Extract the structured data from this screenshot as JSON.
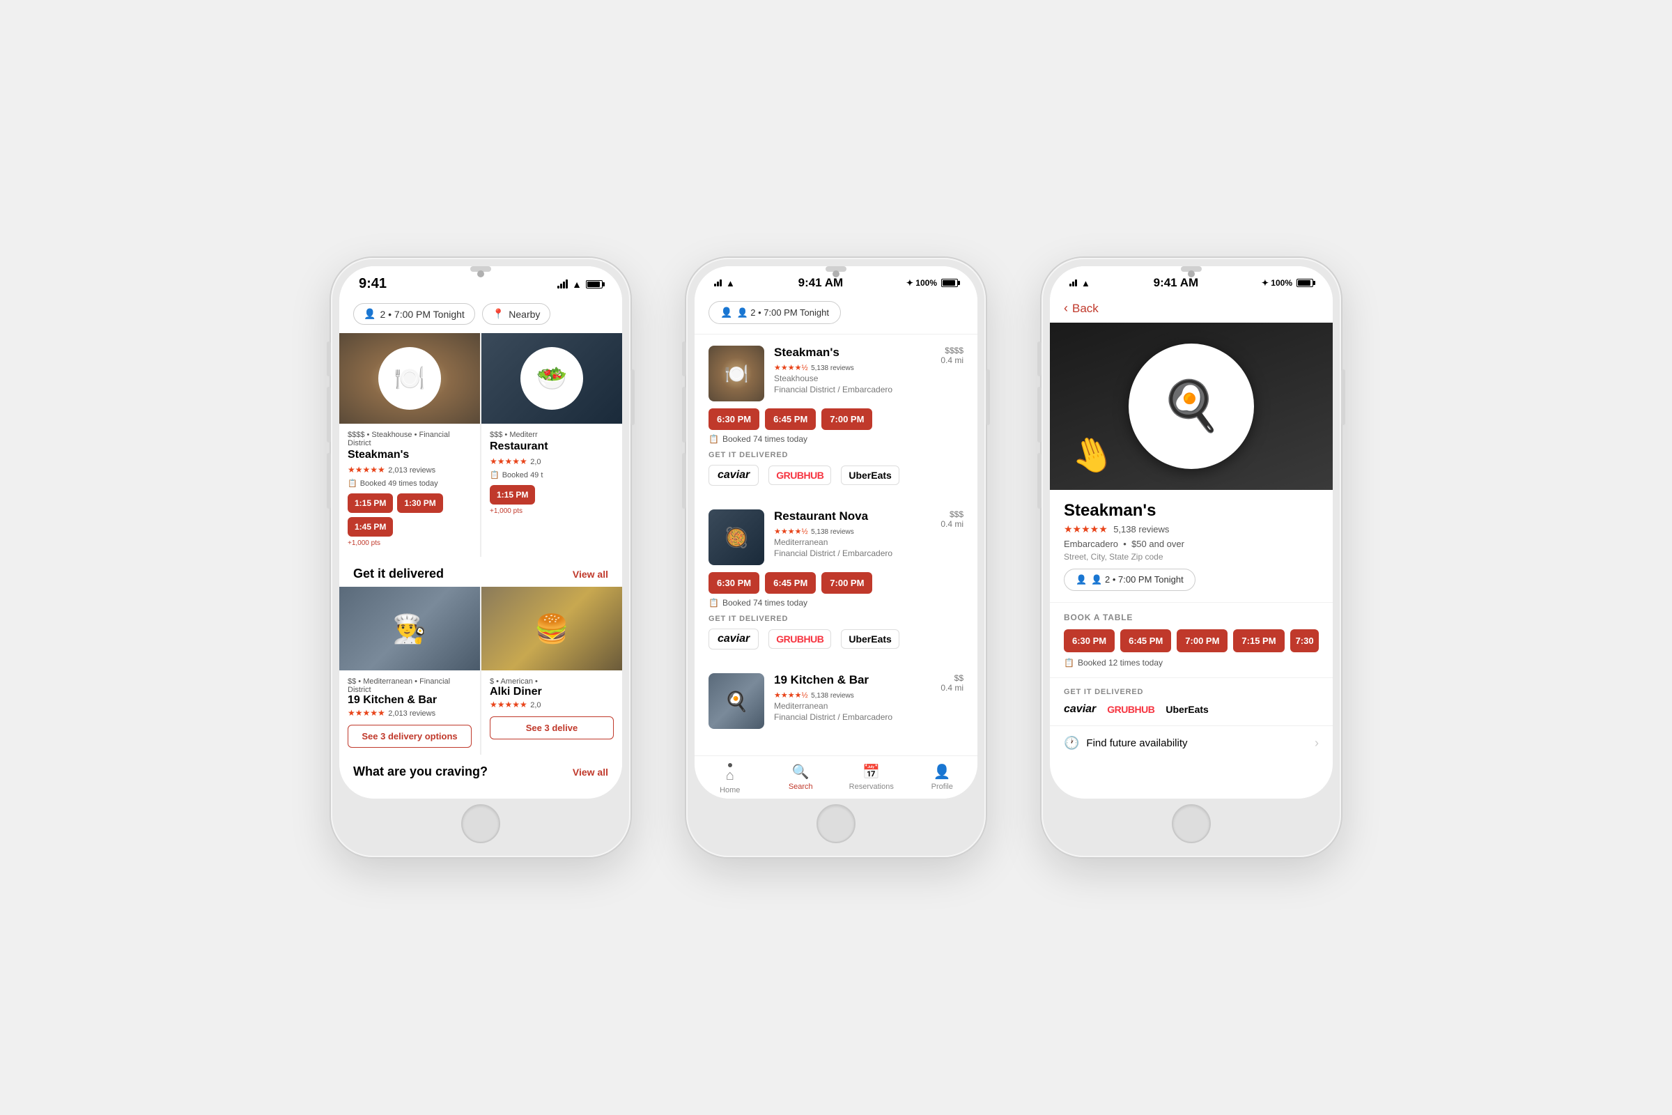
{
  "scene": {
    "background": "#f0f0f0"
  },
  "phone1": {
    "time": "9:41",
    "filter1": {
      "icon": "👤",
      "label": "2 • 7:00 PM Tonight"
    },
    "filter2": {
      "icon": "📍",
      "label": "Nearby"
    },
    "restaurant1": {
      "category": "$$$$ • Steakhouse • Financial District",
      "name": "Steakman's",
      "stars": "★★★★★",
      "reviews": "2,013 reviews",
      "booked": "Booked 49 times today",
      "slots": [
        "1:15 PM",
        "1:30 PM",
        "1:45 PM"
      ],
      "points": "+1,000 pts"
    },
    "restaurant2": {
      "category": "$$$ • Mediterr",
      "name": "Restaurant",
      "stars": "★★★★★",
      "reviews": "2,0",
      "booked": "Booked 49 t",
      "slots": [
        "1:15 PM"
      ],
      "points": "+1,000 pts"
    },
    "get_delivered_title": "Get it delivered",
    "view_all": "View all",
    "delivery1": {
      "category": "$$ • Mediterranean • Financial District",
      "name": "19 Kitchen & Bar",
      "stars": "★★★★★",
      "reviews": "2,013 reviews",
      "btn": "See 3 delivery options"
    },
    "delivery2": {
      "category": "$ • American •",
      "name": "Alki Diner",
      "stars": "★★★★★",
      "reviews": "2,0",
      "btn": "See 3 delive"
    },
    "what_craving": "What are you craving?",
    "view_all2": "View all"
  },
  "phone2": {
    "time": "9:41 AM",
    "bluetooth": "✦ 100%",
    "guest_pill": "👤 2 • 7:00 PM Tonight",
    "restaurant1": {
      "name": "Steakman's",
      "stars": "★★★★½",
      "reviews": "5,138 reviews",
      "price": "$$$$",
      "type": "Steakhouse",
      "location": "Financial District / Embarcadero",
      "distance": "0.4 mi",
      "slots": [
        "6:30 PM",
        "6:45 PM",
        "7:00 PM"
      ],
      "booked": "Booked 74 times today",
      "delivery_label": "GET IT DELIVERED",
      "delivery": [
        "caviar",
        "GRUBHUB",
        "Uber Eats"
      ]
    },
    "restaurant2": {
      "name": "Restaurant Nova",
      "stars": "★★★★½",
      "reviews": "5,138 reviews",
      "price": "$$$",
      "type": "Mediterranean",
      "location": "Financial District / Embarcadero",
      "distance": "0.4 mi",
      "slots": [
        "6:30 PM",
        "6:45 PM",
        "7:00 PM"
      ],
      "booked": "Booked 74 times today",
      "delivery_label": "GET IT DELIVERED",
      "delivery": [
        "caviar",
        "GRUBHUB",
        "Uber Eats"
      ]
    },
    "restaurant3": {
      "name": "19 Kitchen & Bar",
      "stars": "★★★★½",
      "reviews": "5,138 reviews",
      "price": "$$",
      "type": "Mediterranean",
      "location": "Financial District / Embarcadero",
      "distance": "0.4 mi"
    },
    "nav": {
      "home": "Home",
      "search": "Search",
      "reservations": "Reservations",
      "profile": "Profile"
    }
  },
  "phone3": {
    "time": "9:41 AM",
    "bluetooth": "✦ 100%",
    "back": "Back",
    "restaurant": {
      "name": "Steakman's",
      "stars": "★★★★★",
      "reviews": "5,138 reviews",
      "location": "Embarcadero",
      "price": "$50 and over",
      "address": "Street, City, State Zip code",
      "guest_pill": "👤 2 • 7:00 PM Tonight"
    },
    "book_label": "BOOK A TABLE",
    "slots": [
      "6:30 PM",
      "6:45 PM",
      "7:00 PM",
      "7:15 PM",
      "7:30"
    ],
    "booked": "Booked 12 times today",
    "delivery_label": "GET IT DELIVERED",
    "delivery": [
      "caviar",
      "GRUBHUB",
      "Uber Eats"
    ],
    "future": "Find future availability"
  }
}
